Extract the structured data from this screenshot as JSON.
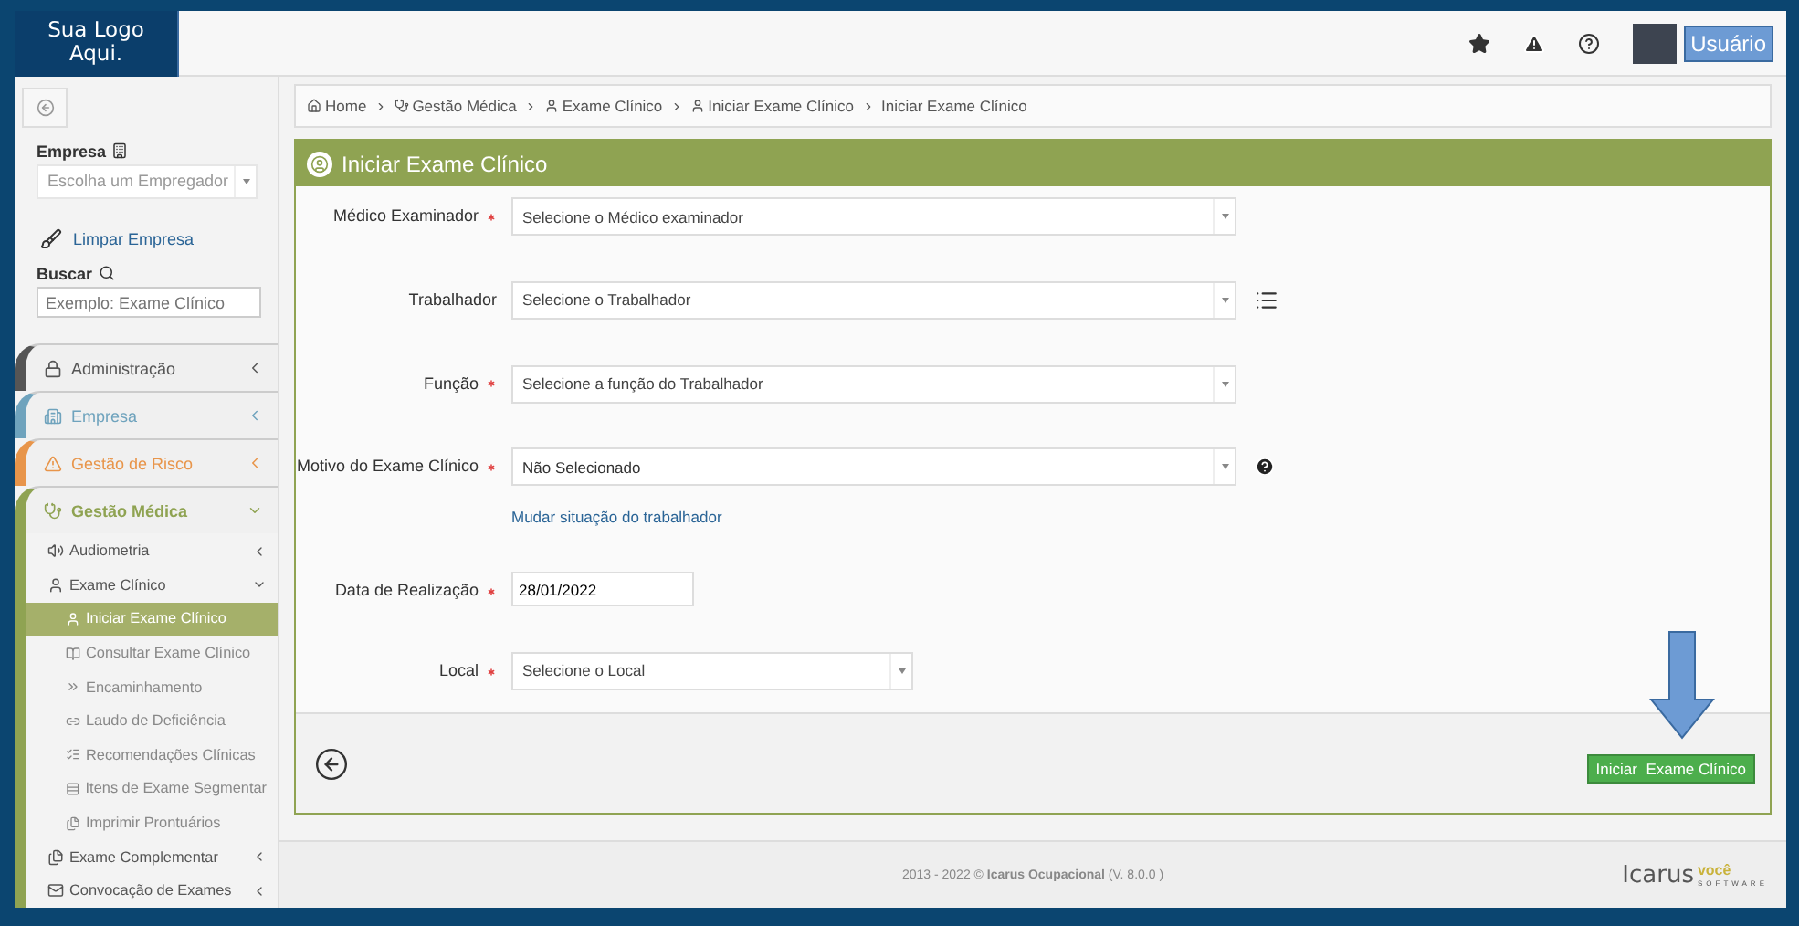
{
  "header": {
    "logo": "Sua Logo Aqui.",
    "user": "Usuário"
  },
  "sidebar": {
    "empresa_label": "Empresa",
    "empresa_placeholder": "Escolha um Empregador",
    "clear": "Limpar Empresa",
    "search_label": "Buscar",
    "search_placeholder": "Exemplo: Exame Clínico",
    "menu": [
      {
        "label": "Administração",
        "color": "#555555",
        "expanded": false
      },
      {
        "label": "Empresa",
        "color": "#6fa3bd",
        "expanded": false
      },
      {
        "label": "Gestão de Risco",
        "color": "#e8954a",
        "expanded": false
      },
      {
        "label": "Gestão Médica",
        "color": "#8fa352",
        "expanded": true,
        "children": [
          {
            "label": "Audiometria",
            "expanded": false
          },
          {
            "label": "Exame Clínico",
            "expanded": true,
            "children": [
              {
                "label": "Iniciar Exame Clínico",
                "selected": true
              },
              {
                "label": "Consultar Exame Clínico",
                "selected": false
              },
              {
                "label": "Encaminhamento",
                "selected": false
              },
              {
                "label": "Laudo de Deficiência",
                "selected": false
              },
              {
                "label": "Recomendações Clínicas",
                "selected": false
              },
              {
                "label": "Itens de Exame Segmentar",
                "selected": false
              },
              {
                "label": "Imprimir Prontuários",
                "selected": false
              }
            ]
          },
          {
            "label": "Exame Complementar",
            "expanded": false
          },
          {
            "label": "Convocação de Exames",
            "expanded": false
          }
        ]
      }
    ]
  },
  "breadcrumb": [
    "Home",
    "Gestão Médica",
    "Exame Clínico",
    "Iniciar Exame Clínico",
    "Iniciar Exame Clínico"
  ],
  "form": {
    "title": "Iniciar Exame Clínico",
    "fields": [
      {
        "label": "Médico Examinador",
        "required": true,
        "kind": "select",
        "placeholder": "Selecione o Médico examinador"
      },
      {
        "label": "Trabalhador",
        "required": false,
        "kind": "select",
        "placeholder": "Selecione o Trabalhador"
      },
      {
        "label": "Função",
        "required": true,
        "kind": "select",
        "placeholder": "Selecione a função do Trabalhador"
      },
      {
        "label": "Motivo do Exame Clínico",
        "required": true,
        "kind": "select",
        "value": "Não Selecionado",
        "link": "Mudar situação do trabalhador"
      },
      {
        "label": "Data de Realização",
        "required": true,
        "kind": "date",
        "value": "28/01/2022"
      },
      {
        "label": "Local",
        "required": true,
        "kind": "compact",
        "placeholder": "Selecione o Local"
      }
    ],
    "submit": "Iniciar  Exame Clínico"
  },
  "footer": {
    "copyright": "2013 - 2022 © **Icarus Ocupacional** (V. 8.0.0 )",
    "brand": "Icarus",
    "brand_suffix": "você",
    "brand_sub": "SOFTWARE"
  }
}
